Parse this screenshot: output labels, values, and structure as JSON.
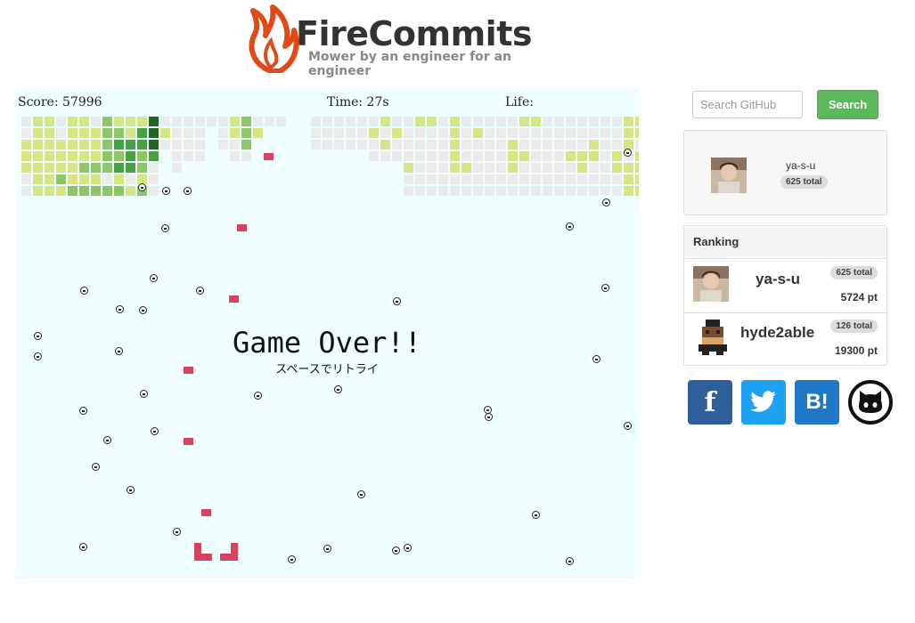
{
  "header": {
    "brand": "FireCommits",
    "tagline": "Mower by an engineer for an engineer"
  },
  "game": {
    "score_label": "Score: 57996",
    "time_label": "Time: 27s",
    "life_label": "Life:",
    "game_over": "Game Over!!",
    "retry_hint": "スペースでリトライ"
  },
  "sidebar": {
    "search_placeholder": "Search GitHub",
    "search_button": "Search",
    "user": {
      "name": "ya-s-u",
      "total": "625 total"
    },
    "ranking": {
      "title": "Ranking",
      "rows": [
        {
          "name": "ya-s-u",
          "total": "625 total",
          "points": "5724 pt"
        },
        {
          "name": "hyde2able",
          "total": "126 total",
          "points": "19300 pt"
        }
      ]
    },
    "social": {
      "facebook": "f",
      "hatena": "B!"
    }
  },
  "colors": {
    "empty": "#ebebeb",
    "level1": "#d6e685",
    "level2": "#8cc665",
    "level3": "#44a340",
    "level4": "#1e6823",
    "bullet": "#d9415f",
    "game_bg": "#effeff",
    "search_green": "#5cb85c",
    "facebook": "#2d5f9a",
    "twitter": "#1da1f2",
    "hatena": "#1f79c7"
  }
}
